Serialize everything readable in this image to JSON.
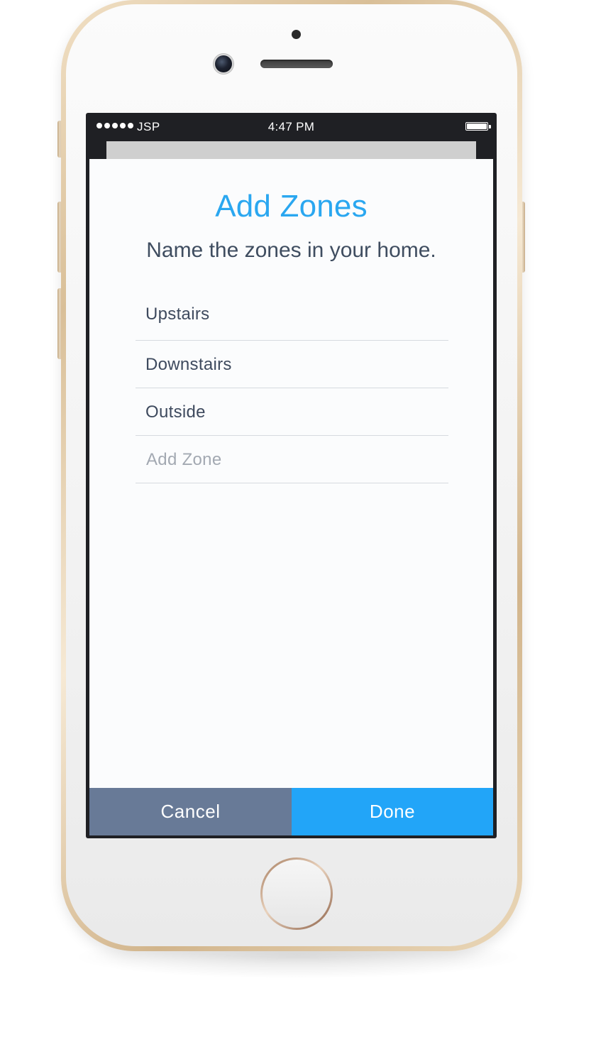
{
  "status_bar": {
    "carrier": "JSP",
    "time": "4:47 PM",
    "signal_dots": 5,
    "battery_level": 1.0
  },
  "screen": {
    "title": "Add Zones",
    "subtitle": "Name the zones in your home.",
    "zones": [
      {
        "label": "Upstairs"
      },
      {
        "label": "Downstairs"
      },
      {
        "label": "Outside"
      }
    ],
    "add_zone": {
      "placeholder": "Add Zone",
      "value": ""
    }
  },
  "actions": {
    "cancel_label": "Cancel",
    "done_label": "Done"
  },
  "colors": {
    "title": "#2aa7f0",
    "cancel_button": "#687a97",
    "done_button": "#22a5f8",
    "phone_frame": "#e3caa4"
  },
  "icons": {
    "signal": "signal-dots-icon",
    "battery": "battery-icon",
    "camera": "front-camera-icon",
    "home": "home-button"
  }
}
